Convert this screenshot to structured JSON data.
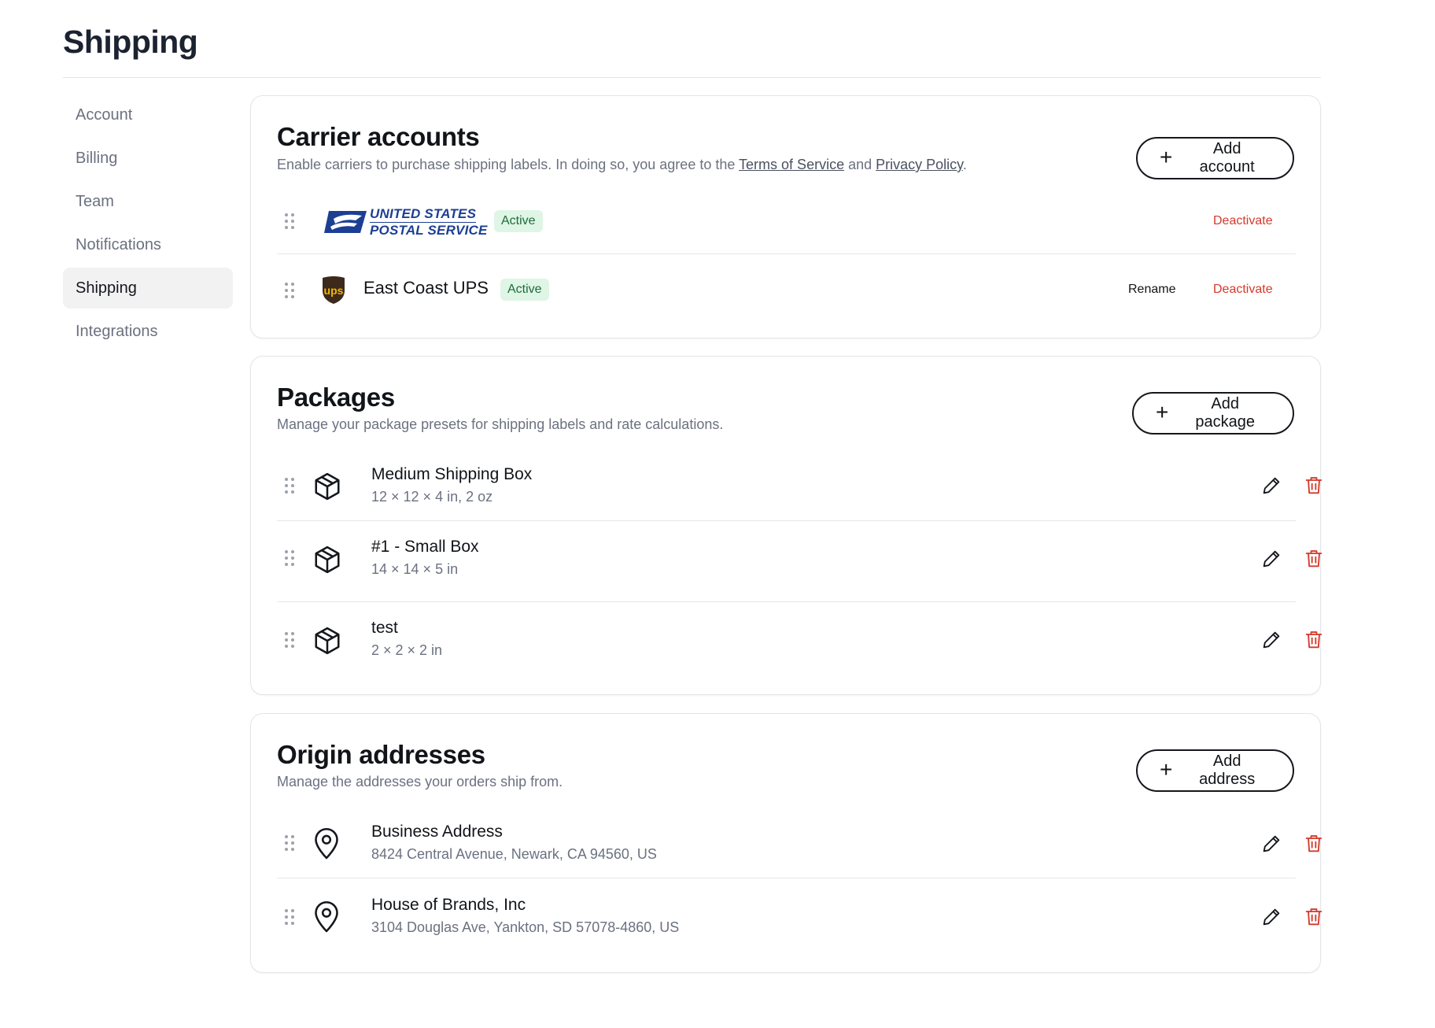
{
  "page": {
    "title": "Shipping"
  },
  "sidebar": {
    "items": [
      {
        "label": "Account"
      },
      {
        "label": "Billing"
      },
      {
        "label": "Team"
      },
      {
        "label": "Notifications"
      },
      {
        "label": "Shipping",
        "active": true
      },
      {
        "label": "Integrations"
      }
    ]
  },
  "carriers": {
    "title": "Carrier accounts",
    "desc_before": "Enable carriers to purchase shipping labels. In doing so, you agree to the ",
    "terms_link": "Terms of Service",
    "desc_and": " and ",
    "privacy_link": "Privacy Policy",
    "desc_after": ".",
    "add_button": "Add account",
    "items": [
      {
        "logo_line1": "UNITED STATES",
        "logo_line2": "POSTAL SERVICE",
        "status": "Active",
        "deactivate": "Deactivate",
        "logo_icon": "usps-eagle-logo"
      },
      {
        "name": "East Coast UPS",
        "status": "Active",
        "rename": "Rename",
        "deactivate": "Deactivate",
        "logo_icon": "ups-shield-logo",
        "logo_text": "ups"
      }
    ]
  },
  "packages": {
    "title": "Packages",
    "desc": "Manage your package presets for shipping labels and rate calculations.",
    "add_button": "Add package",
    "items": [
      {
        "name": "Medium Shipping Box",
        "dims": "12 × 12 × 4 in, 2 oz"
      },
      {
        "name": "#1 - Small Box",
        "dims": "14 × 14 × 5 in"
      },
      {
        "name": "test",
        "dims": "2 × 2 × 2 in"
      }
    ]
  },
  "addresses": {
    "title": "Origin addresses",
    "desc": "Manage the addresses your orders ship from.",
    "add_button": "Add address",
    "items": [
      {
        "name": "Business Address",
        "address": "8424 Central Avenue, Newark, CA 94560, US"
      },
      {
        "name": "House of Brands, Inc",
        "address": "3104 Douglas Ave, Yankton, SD 57078-4860, US"
      }
    ]
  },
  "colors": {
    "accent_red": "#d43a2c",
    "active_badge_bg": "#dff5e6",
    "active_badge_text": "#1d6b3a",
    "usps_blue": "#1c3f94",
    "ups_brown": "#3d2a1c",
    "ups_gold": "#f5b700"
  }
}
